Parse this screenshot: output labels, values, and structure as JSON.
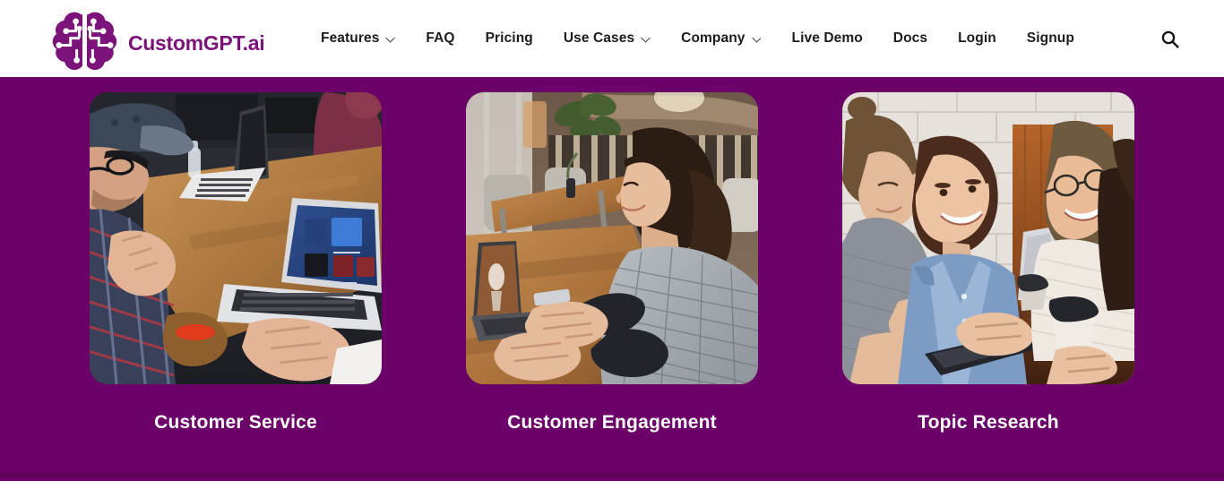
{
  "header": {
    "logo": {
      "icon": "brain-circuit-icon",
      "text": "CustomGPT.ai",
      "color": "#7b137b"
    },
    "nav_items": [
      {
        "label": "Features",
        "has_dropdown": true,
        "icon": "chevron-down-icon"
      },
      {
        "label": "FAQ",
        "has_dropdown": false,
        "icon": ""
      },
      {
        "label": "Pricing",
        "has_dropdown": false,
        "icon": ""
      },
      {
        "label": "Use Cases",
        "has_dropdown": true,
        "icon": "chevron-down-icon"
      },
      {
        "label": "Company",
        "has_dropdown": true,
        "icon": "chevron-down-icon"
      },
      {
        "label": "Live Demo",
        "has_dropdown": false,
        "icon": ""
      },
      {
        "label": "Docs",
        "has_dropdown": false,
        "icon": ""
      },
      {
        "label": "Login",
        "has_dropdown": false,
        "icon": ""
      },
      {
        "label": "Signup",
        "has_dropdown": false,
        "icon": ""
      }
    ],
    "search": {
      "icon": "search-icon",
      "label": "Search"
    }
  },
  "hero": {
    "background_color": "#6b0069",
    "cards": [
      {
        "caption": "Customer Service",
        "image_alt": "Man in plaid shirt and cap gesturing at a laptop on a wooden conference table with colleagues"
      },
      {
        "caption": "Customer Engagement",
        "image_alt": "Woman in checkered blazer typing on a laptop at a wooden cafe table"
      },
      {
        "caption": "Topic Research",
        "image_alt": "Four young people smiling around a tablet at a wooden table near a white brick wall"
      }
    ]
  },
  "colors": {
    "brand_purple": "#6b0069",
    "logo_purple": "#7b137b",
    "nav_text": "#1c1c1c",
    "caption_text": "#ffffff"
  }
}
